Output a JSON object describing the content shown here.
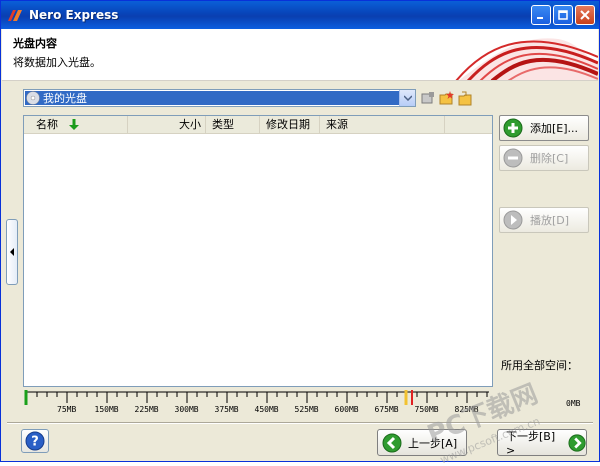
{
  "window": {
    "title": "Nero Express"
  },
  "header": {
    "title": "光盘内容",
    "subtitle": "将数据加入光盘。"
  },
  "disc": {
    "selected": "我的光盘"
  },
  "columns": [
    "名称",
    "大小",
    "类型",
    "修改日期",
    "来源"
  ],
  "buttons": {
    "add": "添加[E]...",
    "delete": "删除[C]",
    "play": "播放[D]",
    "back": "上一步[A]",
    "next": "下一步[B] >"
  },
  "space": {
    "label": "所用全部空间：",
    "unit": "0MB"
  },
  "ruler": [
    "75MB",
    "150MB",
    "225MB",
    "300MB",
    "375MB",
    "450MB",
    "525MB",
    "600MB",
    "675MB",
    "750MB",
    "825MB"
  ],
  "watermark": {
    "main": "PC下载网",
    "sub": "www.pcsoft.com.cn"
  },
  "colors": {
    "titlebar": "#0a3fb0",
    "selection": "#316ac5",
    "green_marker": "#1aa01a",
    "yellow_marker": "#f2c230",
    "red_marker": "#e02020"
  }
}
